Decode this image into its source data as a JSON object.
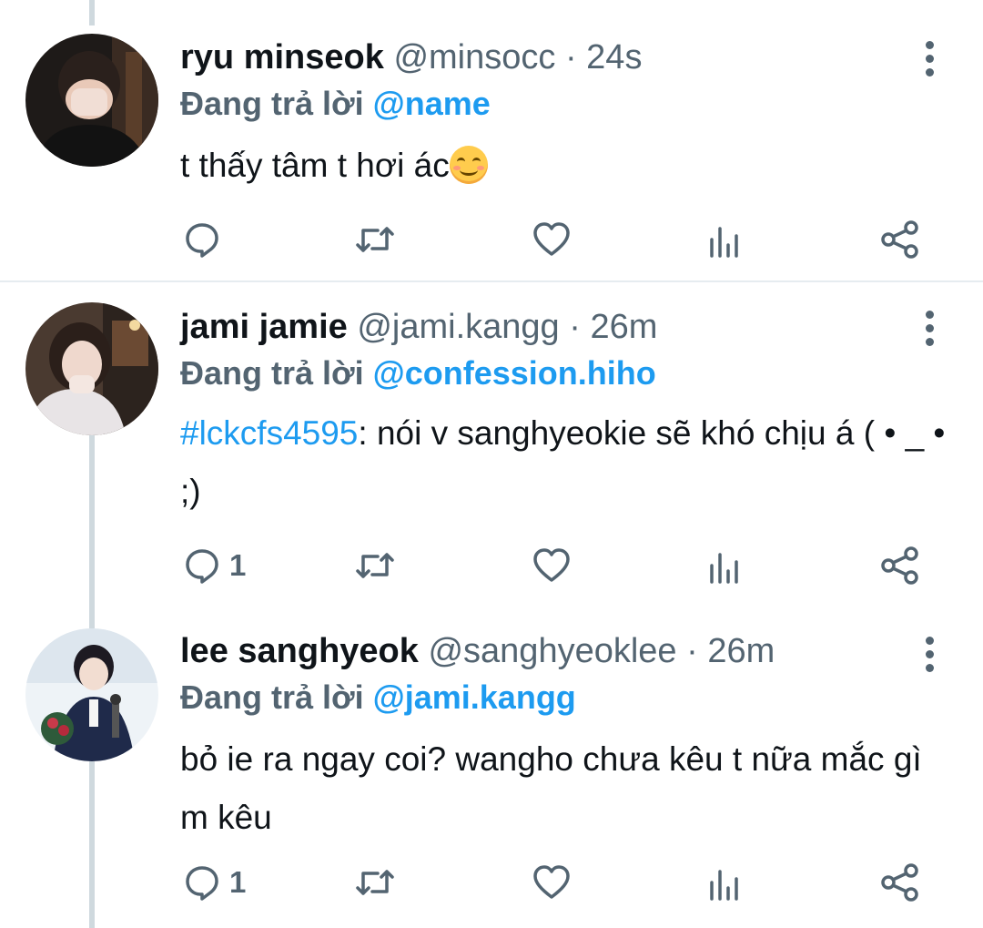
{
  "tweets": [
    {
      "name": "ryu minseok",
      "handle": "@minsocc",
      "separator": "·",
      "time": "24s",
      "reply_prefix": "Đang trả lời",
      "reply_to": "@name",
      "text": "t thấy tâm t hơi ác",
      "emoji": "smiling-face-with-smiling-eyes",
      "reply_count": ""
    },
    {
      "name": "jami jamie",
      "handle": "@jami.kangg",
      "separator": "·",
      "time": "26m",
      "reply_prefix": "Đang trả lời",
      "reply_to": "@confession.hiho",
      "hashtag": "#lckcfs4595",
      "text": ": nói v sanghyeokie sẽ khó chịu á ( • _ • ;)",
      "reply_count": "1"
    },
    {
      "name": "lee sanghyeok",
      "handle": "@sanghyeoklee",
      "separator": "·",
      "time": "26m",
      "reply_prefix": "Đang trả lời",
      "reply_to": "@jami.kangg",
      "text": "bỏ ie ra ngay coi? wangho chưa kêu t nữa mắc gì m kêu",
      "reply_count": "1"
    }
  ],
  "colors": {
    "link": "#1d9bf0",
    "secondary": "#536471",
    "thread_line": "#cfd9de",
    "divider": "#e6ecf0"
  },
  "icons": [
    "reply-icon",
    "retweet-icon",
    "like-icon",
    "analytics-icon",
    "share-icon",
    "more-icon"
  ]
}
